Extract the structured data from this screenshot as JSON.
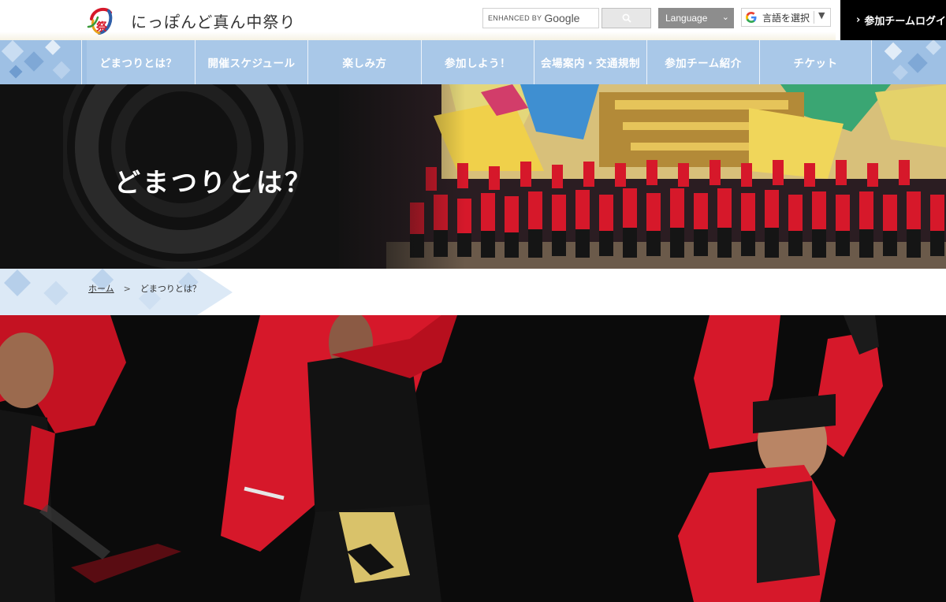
{
  "site": {
    "logo_text": "にっぽんど真ん中祭り",
    "logo_mark_text": "祭"
  },
  "search": {
    "prefix": "ENHANCED BY",
    "provider": "Google"
  },
  "language": {
    "selected": "Language"
  },
  "translate": {
    "label": "言語を選択",
    "caret": "▼"
  },
  "login": {
    "label": "参加チームログイン"
  },
  "nav": {
    "items": [
      {
        "label": "どまつりとは？"
      },
      {
        "label": "開催スケジュール"
      },
      {
        "label": "楽しみ方"
      },
      {
        "label": "参加しよう！"
      },
      {
        "label": "会場案内・交通規制"
      },
      {
        "label": "参加チーム紹介"
      },
      {
        "label": "チケット"
      }
    ]
  },
  "hero": {
    "title": "どまつりとは？"
  },
  "breadcrumb": {
    "home": "ホーム",
    "separator": ">",
    "current": "どまつりとは？"
  },
  "colors": {
    "nav_bg": "#a9c8e8",
    "hero_bg": "#111111",
    "login_bg": "#000000",
    "costume_red": "#d6182a",
    "costume_black": "#141414"
  }
}
